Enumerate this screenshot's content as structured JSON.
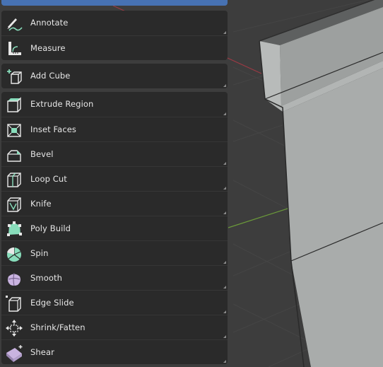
{
  "toolbar": {
    "tools": [
      {
        "label": "Annotate",
        "icon": "annotate-icon"
      },
      {
        "label": "Measure",
        "icon": "measure-icon"
      },
      {
        "label": "Add Cube",
        "icon": "add-cube-icon"
      },
      {
        "label": "Extrude Region",
        "icon": "extrude-region-icon"
      },
      {
        "label": "Inset Faces",
        "icon": "inset-faces-icon"
      },
      {
        "label": "Bevel",
        "icon": "bevel-icon"
      },
      {
        "label": "Loop Cut",
        "icon": "loop-cut-icon"
      },
      {
        "label": "Knife",
        "icon": "knife-icon"
      },
      {
        "label": "Poly Build",
        "icon": "poly-build-icon"
      },
      {
        "label": "Spin",
        "icon": "spin-icon"
      },
      {
        "label": "Smooth",
        "icon": "smooth-icon"
      },
      {
        "label": "Edge Slide",
        "icon": "edge-slide-icon"
      },
      {
        "label": "Shrink/Fatten",
        "icon": "shrink-fatten-icon"
      },
      {
        "label": "Shear",
        "icon": "shear-icon"
      }
    ]
  },
  "colors": {
    "viewport_background": "#3d3d3d",
    "panel": "#2a2a2a",
    "active_tool": "#4772b3",
    "x_axis": "#9b3a44",
    "y_axis": "#6b9a3a",
    "mesh_face": "#a9acab",
    "icon_accent": "#88ddbb"
  }
}
